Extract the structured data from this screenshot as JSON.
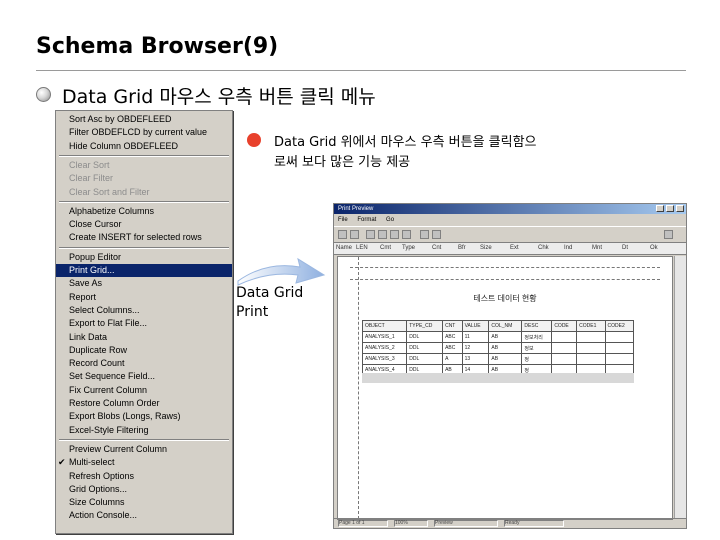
{
  "slide": {
    "title": "Schema Browser(9)",
    "bullet": "Data Grid  마우스 우측 버튼 클릭 메뉴"
  },
  "callout": {
    "line1": "Data Grid 위에서 마우스 우측 버튼을 클릭함으",
    "line2": "로써 보다 많은 기능 제공",
    "dot_color": "#e8412c"
  },
  "caption": {
    "line1": "Data Grid",
    "line2": "Print"
  },
  "menu": {
    "items": [
      {
        "label": "Sort Asc by OBDEFLEED",
        "disabled": false
      },
      {
        "label": "Filter OBDEFLCD by current value",
        "disabled": false
      },
      {
        "label": "Hide Column OBDEFLEED",
        "disabled": false
      },
      {
        "label": "Clear Sort",
        "disabled": true
      },
      {
        "label": "Clear Filter",
        "disabled": true
      },
      {
        "label": "Clear Sort and Filter",
        "disabled": true
      },
      {
        "label": "Alphabetize Columns",
        "disabled": false
      },
      {
        "label": "Close Cursor",
        "disabled": false
      },
      {
        "label": "Create INSERT for selected rows",
        "disabled": false
      },
      {
        "label": "Popup Editor",
        "disabled": false
      },
      {
        "label": "Print Grid...",
        "disabled": false
      },
      {
        "label": "Save As",
        "disabled": false
      },
      {
        "label": "Report",
        "disabled": false
      },
      {
        "label": "Select Columns...",
        "disabled": false
      },
      {
        "label": "Export to Flat File...",
        "disabled": false
      },
      {
        "label": "Link Data",
        "disabled": false
      },
      {
        "label": "Duplicate Row",
        "disabled": false
      },
      {
        "label": "Record Count",
        "disabled": false
      },
      {
        "label": "Set Sequence Field...",
        "disabled": false
      },
      {
        "label": "Fix Current Column",
        "disabled": false
      },
      {
        "label": "Restore Column Order",
        "disabled": false
      },
      {
        "label": "Export Blobs (Longs, Raws)",
        "disabled": false
      },
      {
        "label": "Excel-Style Filtering",
        "disabled": false
      },
      {
        "label": "Preview Current Column",
        "disabled": false
      },
      {
        "label": "Multi-select",
        "disabled": false
      },
      {
        "label": "Refresh Options",
        "disabled": false
      },
      {
        "label": "Grid Options...",
        "disabled": false
      },
      {
        "label": "Size Columns",
        "disabled": false
      },
      {
        "label": "Action Console...",
        "disabled": false
      }
    ],
    "selected_label": "Print Grid..."
  },
  "preview": {
    "window_title": "Print Preview",
    "menu": [
      "File",
      "Format",
      "Go"
    ],
    "header_cells": [
      "Name",
      "LEN",
      "Cmt",
      "Type",
      "Cnt",
      "Bfr",
      "Size",
      "Ext",
      "Chk",
      "Ind",
      "Mnt",
      "Dt",
      "Ok"
    ],
    "doc_title": "테스트 데이터 현황",
    "grid": {
      "headers": [
        "OBJECT",
        "TYPE_CD",
        "CNT",
        "VALUE",
        "COL_NM",
        "DESC",
        "CODE",
        "CODE1",
        "CODE2"
      ],
      "rows": [
        [
          "ANALYSIS_1",
          "DDL",
          "ABC",
          "11",
          "AB",
          "정보처리",
          "",
          "",
          ""
        ],
        [
          "ANALYSIS_2",
          "DDL",
          "ABC",
          "12",
          "AB",
          "정보",
          "",
          "",
          ""
        ],
        [
          "ANALYSIS_3",
          "DDL",
          "A",
          "13",
          "AB",
          "정",
          "",
          "",
          ""
        ],
        [
          "ANALYSIS_4",
          "DDL",
          "AB",
          "14",
          "AB",
          "정",
          "",
          "",
          ""
        ]
      ]
    },
    "status": [
      "Page 1 of 1",
      "100%",
      "Preview",
      "Ready"
    ]
  }
}
